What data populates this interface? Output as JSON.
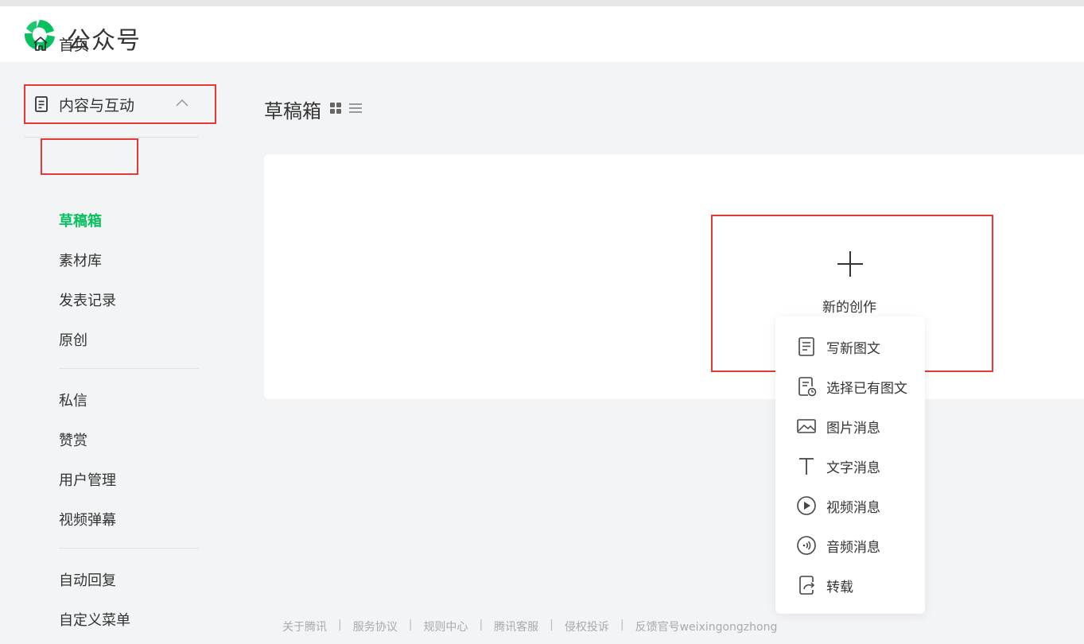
{
  "header": {
    "brand": "公众号",
    "logo_icon": "wechat-mp-logo",
    "accent": "#07c160"
  },
  "sidebar": {
    "home": "首页",
    "group": "内容与互动",
    "items": [
      {
        "label": "草稿箱",
        "active": true
      },
      {
        "label": "素材库"
      },
      {
        "label": "发表记录"
      },
      {
        "label": "原创"
      },
      {
        "label": "私信"
      },
      {
        "label": "赞赏"
      },
      {
        "label": "用户管理"
      },
      {
        "label": "视频弹幕"
      },
      {
        "label": "自动回复"
      },
      {
        "label": "自定义菜单"
      }
    ]
  },
  "main": {
    "title": "草稿箱",
    "create_label": "新的创作",
    "menu": [
      {
        "label": "写新图文",
        "icon": "document-icon"
      },
      {
        "label": "选择已有图文",
        "icon": "document-clock-icon"
      },
      {
        "label": "图片消息",
        "icon": "image-icon"
      },
      {
        "label": "文字消息",
        "icon": "text-icon"
      },
      {
        "label": "视频消息",
        "icon": "play-icon"
      },
      {
        "label": "音频消息",
        "icon": "audio-icon"
      },
      {
        "label": "转载",
        "icon": "repost-icon"
      }
    ]
  },
  "footer": {
    "links": [
      "关于腾讯",
      "服务协议",
      "规则中心",
      "腾讯客服",
      "侵权投诉",
      "反馈官号weixingongzhong"
    ]
  },
  "highlight_color": "#e53935"
}
